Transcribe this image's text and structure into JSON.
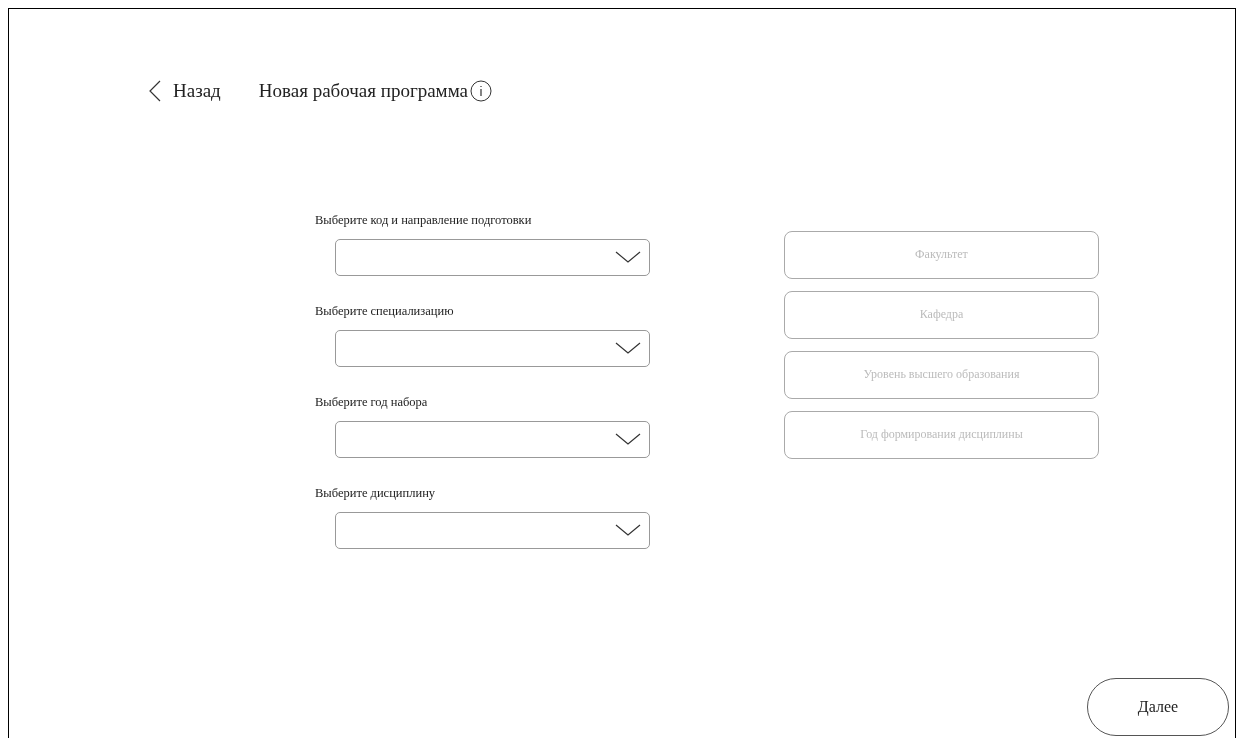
{
  "header": {
    "back": "Назад",
    "title": "Новая рабочая программа"
  },
  "selects": [
    {
      "label": "Выберите код и направление подготовки"
    },
    {
      "label": "Выберите специализацию"
    },
    {
      "label": "Выберите год набора"
    },
    {
      "label": "Выберите дисциплину"
    }
  ],
  "info_fields": [
    {
      "placeholder": "Факультет",
      "disabled": true
    },
    {
      "placeholder": "Кафедра",
      "disabled": true
    },
    {
      "placeholder": "Уровень высшего образования",
      "disabled": true
    },
    {
      "placeholder": "Год формирования дисциплины",
      "disabled": true
    }
  ],
  "next_button": "Далее"
}
